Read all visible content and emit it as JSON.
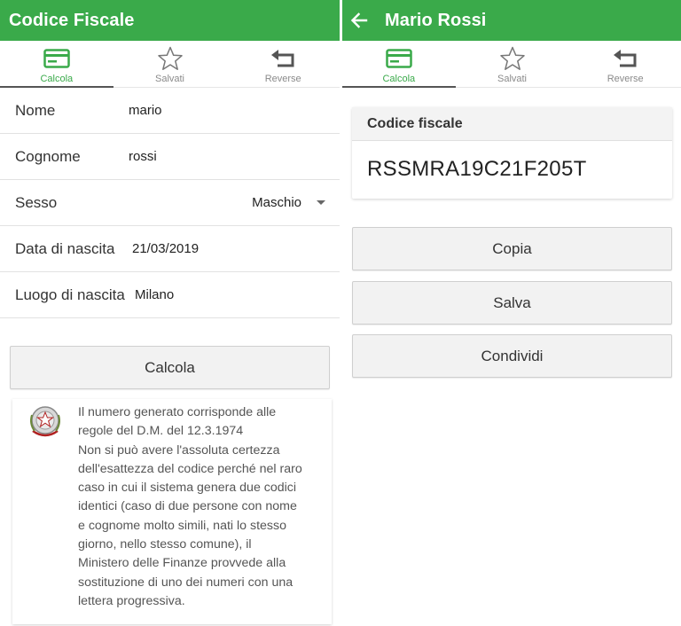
{
  "colors": {
    "primary": "#3aaa4a",
    "tab_indicator": "#555555"
  },
  "left": {
    "title": "Codice Fiscale",
    "tabs": [
      {
        "label": "Calcola",
        "icon": "credit-card-icon",
        "active": true
      },
      {
        "label": "Salvati",
        "icon": "star-outline-icon",
        "active": false
      },
      {
        "label": "Reverse",
        "icon": "undo-arrow-icon",
        "active": false
      }
    ],
    "form": {
      "nome": {
        "label": "Nome",
        "value": "mario"
      },
      "cognome": {
        "label": "Cognome",
        "value": "rossi"
      },
      "sesso": {
        "label": "Sesso",
        "value": "Maschio"
      },
      "data": {
        "label": "Data di nascita",
        "value": "21/03/2019"
      },
      "luogo": {
        "label": "Luogo di nascita",
        "value": "Milano"
      }
    },
    "calcola_button": "Calcola",
    "info": {
      "emblem_icon": "italian-republic-emblem-icon",
      "lines": [
        "Il numero generato corrisponde alle",
        "regole del D.M. del 12.3.1974",
        "Non si può avere l'assoluta certezza",
        "dell'esattezza del codice perché nel raro",
        "caso in cui il sistema genera due codici",
        "identici (caso di due persone con nome",
        "e cognome molto simili, nati lo stesso",
        "giorno, nello stesso comune), il",
        "Ministero delle Finanze provvede alla",
        "sostituzione di uno dei numeri con una",
        "lettera progressiva."
      ]
    }
  },
  "right": {
    "title": "Mario Rossi",
    "back_icon": "arrow-back-icon",
    "tabs": [
      {
        "label": "Calcola",
        "icon": "credit-card-icon",
        "active": true
      },
      {
        "label": "Salvati",
        "icon": "star-outline-icon",
        "active": false
      },
      {
        "label": "Reverse",
        "icon": "undo-arrow-icon",
        "active": false
      }
    ],
    "result": {
      "header": "Codice fiscale",
      "code": "RSSMRA19C21F205T"
    },
    "buttons": {
      "copia": "Copia",
      "salva": "Salva",
      "condividi": "Condividi"
    }
  }
}
